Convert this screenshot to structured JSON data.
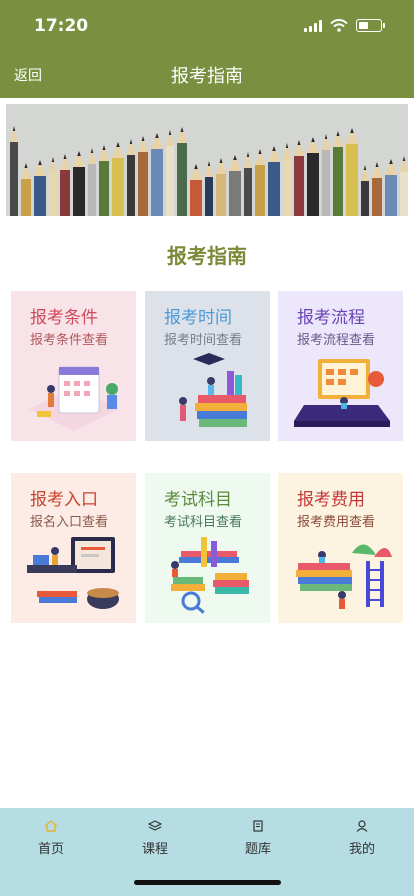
{
  "status_bar": {
    "time": "17:20"
  },
  "nav": {
    "back_label": "返回",
    "title": "报考指南"
  },
  "section": {
    "title": "报考指南"
  },
  "cards": [
    {
      "title": "报考条件",
      "subtitle": "报考条件查看",
      "bg": "#f7e3e8",
      "title_color": "#d14a5a",
      "sub_color": "#b25a5a"
    },
    {
      "title": "报考时间",
      "subtitle": "报考时间查看",
      "bg": "#dde2ea",
      "title_color": "#4a9bd8",
      "sub_color": "#777d85"
    },
    {
      "title": "报考流程",
      "subtitle": "报考流程查看",
      "bg": "#ece7fb",
      "title_color": "#6a44b6",
      "sub_color": "#6a5a8a"
    },
    {
      "title": "报考入口",
      "subtitle": "报名入口查看",
      "bg": "#fcece5",
      "title_color": "#c8452f",
      "sub_color": "#8a5a4a"
    },
    {
      "title": "考试科目",
      "subtitle": "考试科目查看",
      "bg": "#eef9ef",
      "title_color": "#5a8a3a",
      "sub_color": "#4a7a5a"
    },
    {
      "title": "报考费用",
      "subtitle": "报考费用查看",
      "bg": "#fcf3e0",
      "title_color": "#c43a3a",
      "sub_color": "#8a4a3a"
    }
  ],
  "tabs": [
    {
      "label": "首页",
      "icon": "home-icon",
      "active_color": "#e3b53a"
    },
    {
      "label": "课程",
      "icon": "layers-icon"
    },
    {
      "label": "题库",
      "icon": "book-icon"
    },
    {
      "label": "我的",
      "icon": "user-icon"
    }
  ]
}
